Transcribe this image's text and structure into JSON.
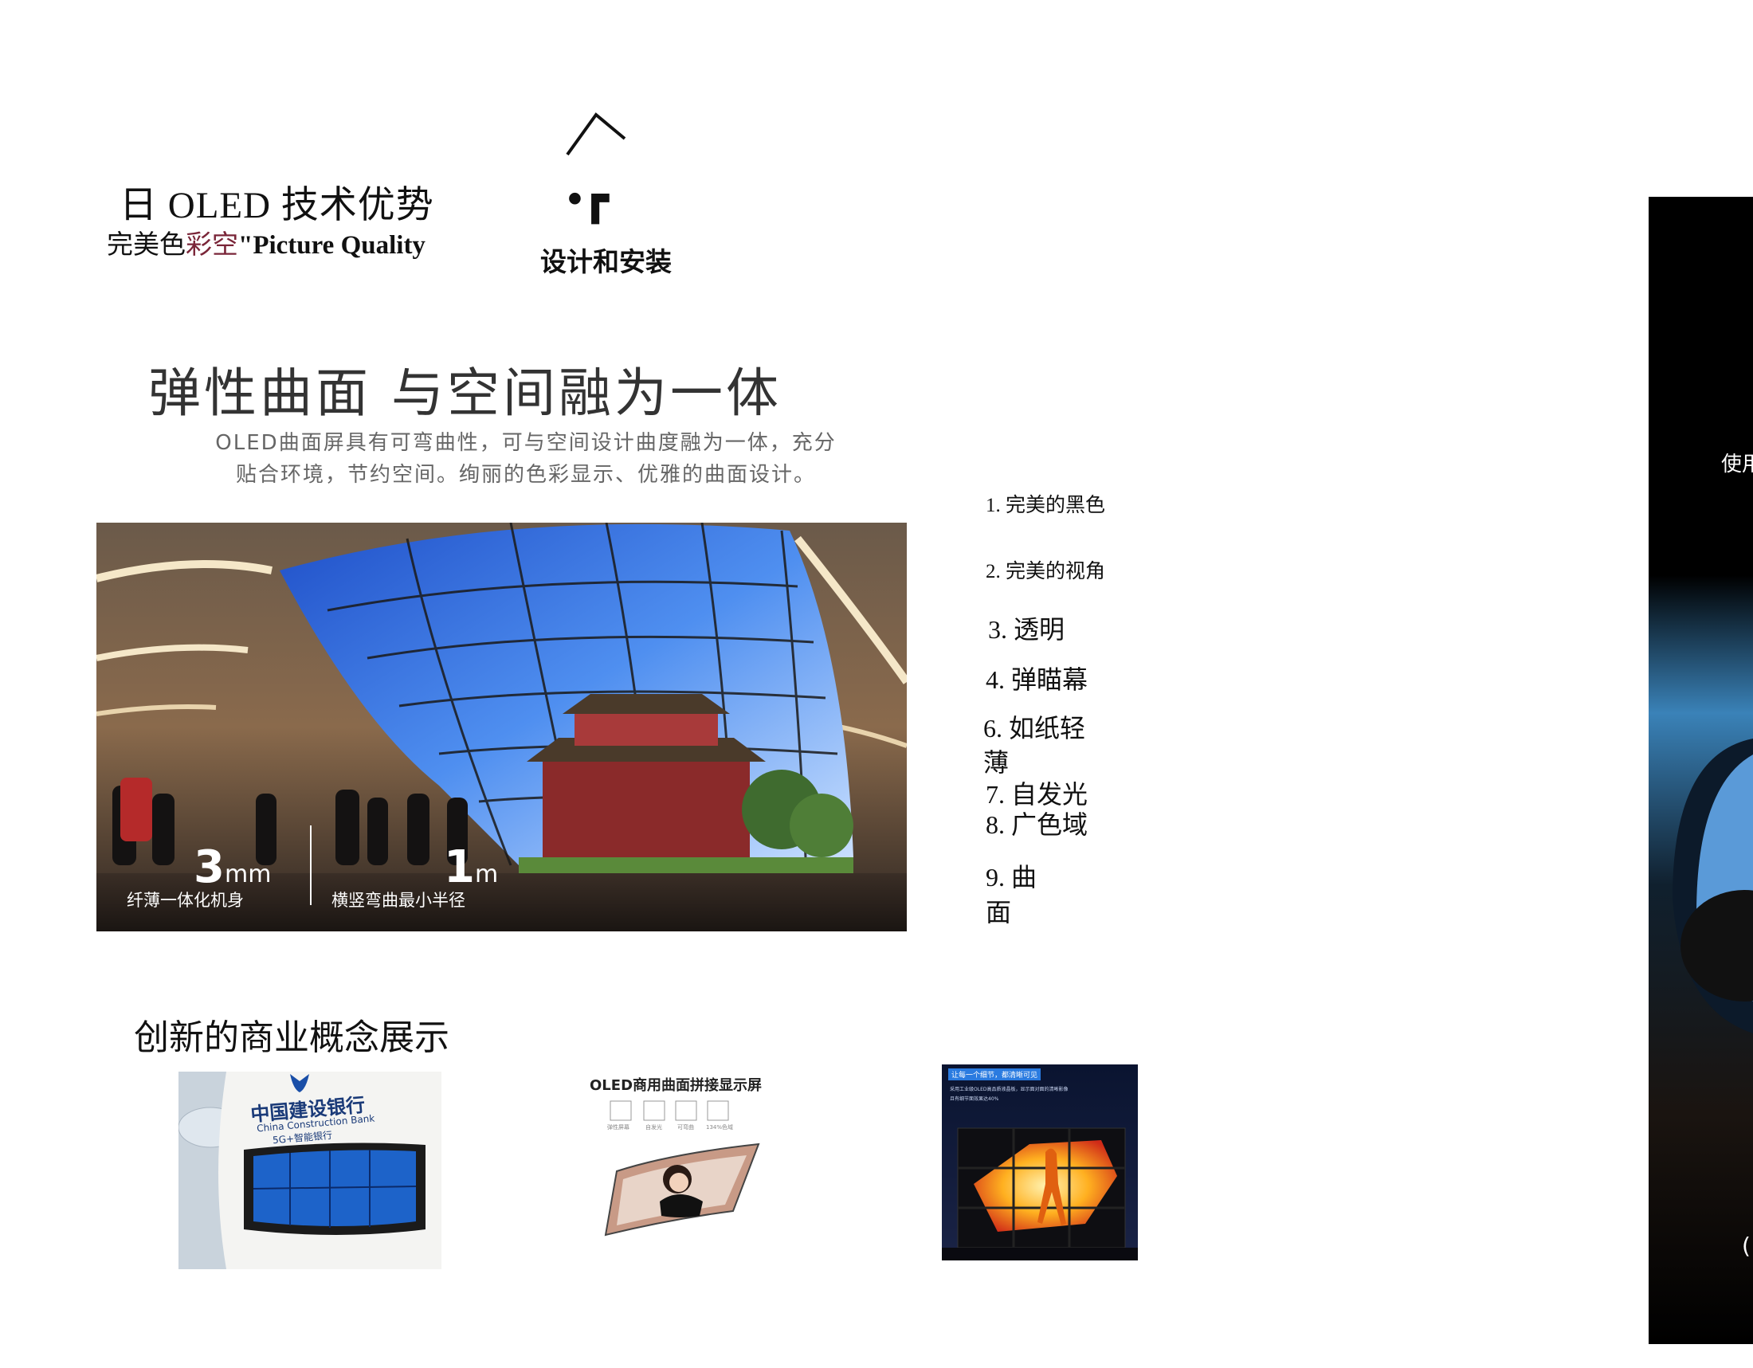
{
  "header": {
    "title": "日 OLED 技术优势",
    "subtitle_part1": "完美色",
    "subtitle_part2": "彩空",
    "subtitle_part3": "\"Picture Quality",
    "mark_glyph": "•┏",
    "design_label": "设计和安装"
  },
  "banner": {
    "headline": "弹性曲面 与空间融为一体",
    "description_line1": "OLED曲面屏具有可弯曲性，可与空间设计曲度融为一体，充分",
    "description_line2": "贴合环境，节约空间。绚丽的色彩显示、优雅的曲面设计。",
    "specs": [
      {
        "value": "3",
        "unit": "mm",
        "caption": "纤薄一体化机身"
      },
      {
        "value": "1",
        "unit": "m",
        "caption": "横竖弯曲最小半径"
      }
    ]
  },
  "advantages": {
    "items": [
      {
        "label": "1. 完美的黑色"
      },
      {
        "label": "2. 完美的视角"
      },
      {
        "label": "3. 透明"
      },
      {
        "label": "4. 弹瞄幕"
      },
      {
        "label_line1": "6. 如纸轻",
        "label_line2": "薄"
      },
      {
        "label": "7. 自发光"
      },
      {
        "label": "8. 广色域"
      },
      {
        "label_line1": "9. 曲",
        "label_line2": "面"
      }
    ]
  },
  "showcase": {
    "title": "创新的商业概念展示",
    "bank_sign_line1": "中国建设银行",
    "bank_sign_line2": "China Construction Bank",
    "bank_sign_line3": "5G+智能银行",
    "product_card_title": "OLED商用曲面拼接显示屏",
    "product_features": [
      "弹性屏幕",
      "自发光",
      "可弯曲",
      "134%色域"
    ],
    "wall_label": "让每一个细节，都清晰可见",
    "wall_caption_line1": "采用工业级OLED高品质液晶板，显示面对面的清晰影像",
    "wall_caption_line2": "且有细节面效果达40%"
  },
  "right_panel": {
    "label": "使用",
    "paren": "("
  },
  "colors": {
    "accent_maroon": "#7a2538",
    "sky_blue": "#4f8ff0",
    "panel_black": "#000000"
  }
}
